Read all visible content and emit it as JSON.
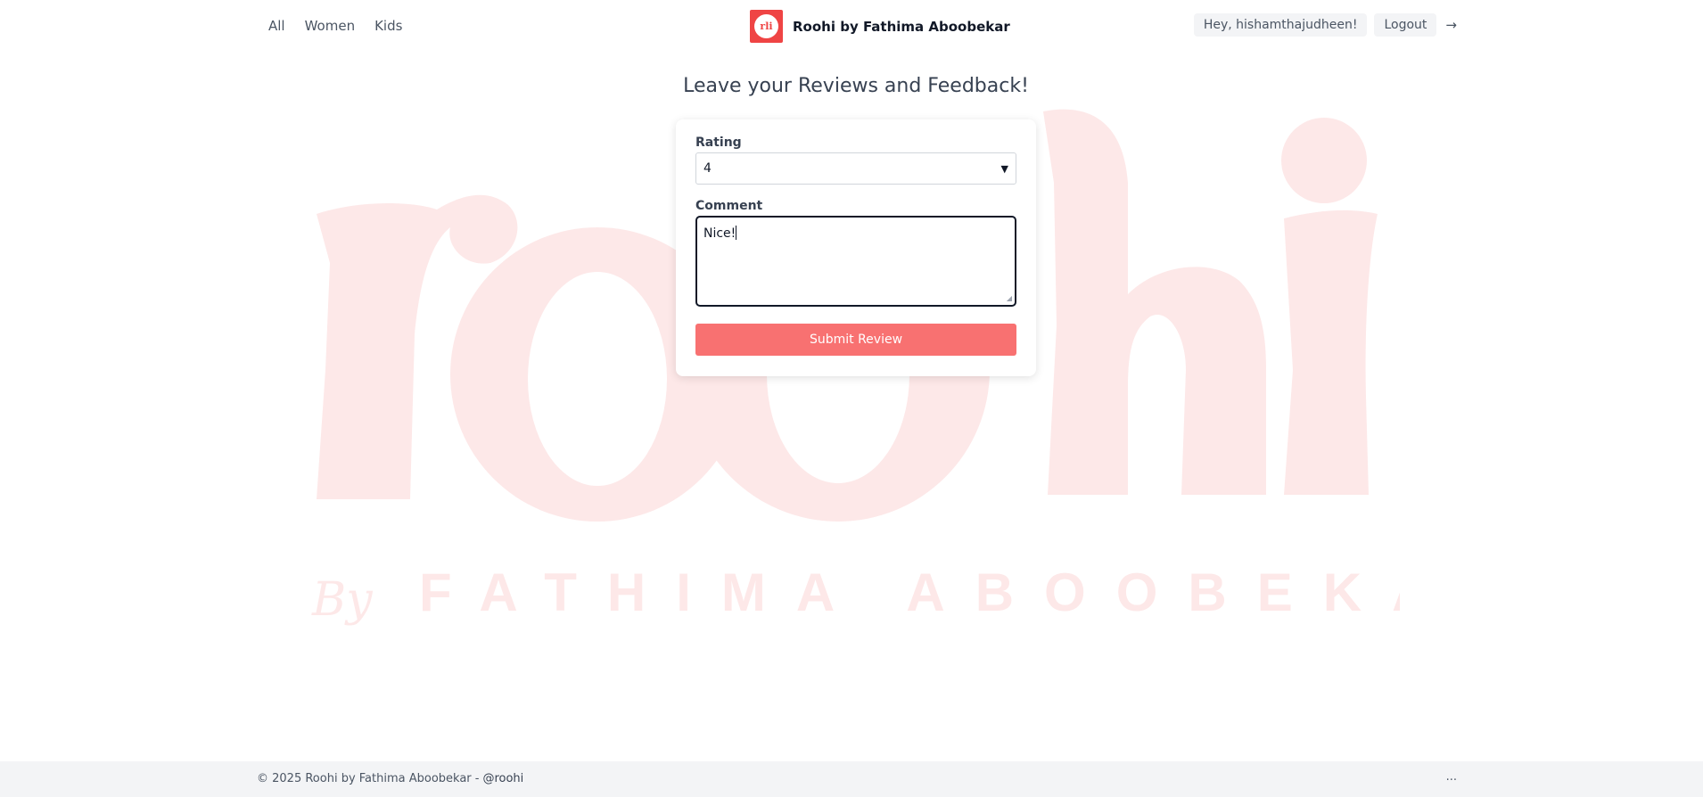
{
  "nav": {
    "links": [
      "All",
      "Women",
      "Kids"
    ]
  },
  "brand": {
    "logo_text": "rli",
    "name": "Roohi by Fathima Aboobekar"
  },
  "user": {
    "greeting": "Hey, hishamthajudheen!",
    "logout_label": "Logout",
    "logout_icon": "arrow-right-icon"
  },
  "watermark": {
    "word": "roohi",
    "by": "By",
    "name": "FATHIMA ABOOBEKAR"
  },
  "page": {
    "title": "Leave your Reviews and Feedback!"
  },
  "form": {
    "rating_label": "Rating",
    "rating_value": "4",
    "comment_label": "Comment",
    "comment_value": "Nice!",
    "submit_label": "Submit Review"
  },
  "footer": {
    "copyright": "© 2025 Roohi by Fathima Aboobekar -",
    "handle": "@roohi",
    "right_text": "..."
  },
  "colors": {
    "accent": "#f87171",
    "brand_red": "#ef4444",
    "watermark": "#fde8e8",
    "footer_bg": "#f3f4f6"
  }
}
